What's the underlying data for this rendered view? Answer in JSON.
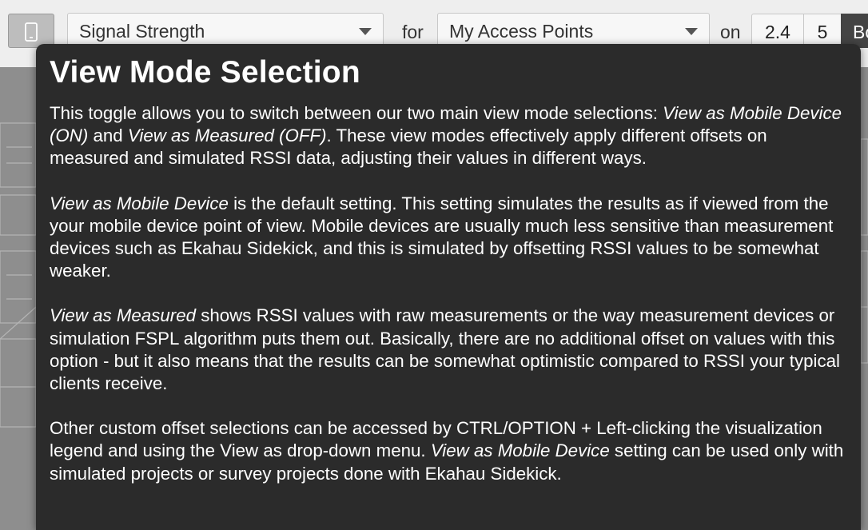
{
  "toolbar": {
    "mobile_toggle_icon": "mobile-device-icon",
    "metric_select": {
      "value": "Signal Strength"
    },
    "for_label": "for",
    "ap_select": {
      "value": "My Access Points"
    },
    "on_label": "on",
    "bands": [
      "2.4",
      "5",
      "Bo"
    ]
  },
  "tooltip": {
    "title": "View Mode Selection",
    "p1": {
      "a": "This toggle allows you to switch between our two main view mode selections: ",
      "b_em": "View as Mobile Device (ON)",
      "c": " and ",
      "d_em": "View as Measured (OFF)",
      "e": ". These view modes effectively apply different offsets on measured and simulated RSSI data, adjusting their values in different ways."
    },
    "p2": {
      "a_em": "View as Mobile Device",
      "b": " is the default setting. This setting simulates the results as if viewed from the your mobile device point of view. Mobile devices are usually much less sensitive than measurement devices such as Ekahau Sidekick, and this is simulated by offsetting RSSI values to be somewhat weaker."
    },
    "p3": {
      "a_em": "View as Measured",
      "b": " shows RSSI values with raw measurements or the way measurement devices or simulation FSPL algorithm puts them out. Basically, there are no additional offset on values with this option - but it also means that the results can be somewhat optimistic compared to RSSI your typical clients receive."
    },
    "p4": {
      "a": "Other custom offset selections can be accessed by CTRL/OPTION + Left-clicking the visualization legend and using the View as drop-down menu. ",
      "b_em": "View as Mobile Device",
      "c": " setting can be used only with simulated projects or survey projects done with Ekahau Sidekick."
    }
  }
}
